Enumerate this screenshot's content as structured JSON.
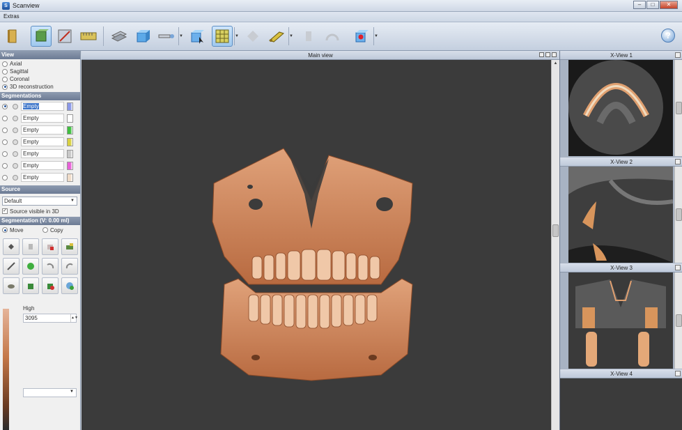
{
  "window": {
    "title": "Scanview",
    "controls": [
      "–",
      "□",
      "✕"
    ]
  },
  "menu": {
    "extras": "Extras"
  },
  "toolbar": {
    "help_label": "?"
  },
  "view": {
    "header": "View",
    "options": [
      "Axial",
      "Sagittal",
      "Coronal",
      "3D reconstruction"
    ],
    "selected": "3D reconstruction"
  },
  "segmentations": {
    "header": "Segmentations",
    "rows": [
      {
        "name": "Empty",
        "color": "#8a98e8"
      },
      {
        "name": "Empty",
        "color": "#ffffff"
      },
      {
        "name": "Empty",
        "color": "#3fbf3f"
      },
      {
        "name": "Empty",
        "color": "#d8d040"
      },
      {
        "name": "Empty",
        "color": "#c8c8c8"
      },
      {
        "name": "Empty",
        "color": "#e860d8"
      },
      {
        "name": "Empty",
        "color": "#f0dcc8"
      }
    ]
  },
  "source": {
    "header": "Source",
    "selected": "Default",
    "visible_label": "Source visible in 3D",
    "visible_checked": true
  },
  "segmentation_tools": {
    "header": "Segmentation (V: 0.00 ml)",
    "move_label": "Move",
    "copy_label": "Copy",
    "high_label": "High",
    "high_value": "3095"
  },
  "main_view": {
    "title": "Main view"
  },
  "xviews": [
    {
      "title": "X-View 1"
    },
    {
      "title": "X-View 2"
    },
    {
      "title": "X-View 3"
    },
    {
      "title": "X-View 4"
    }
  ]
}
